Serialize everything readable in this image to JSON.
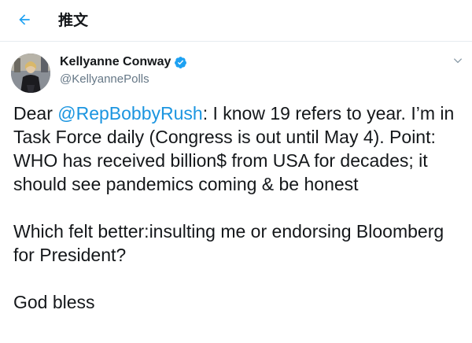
{
  "header": {
    "title": "推文",
    "back_icon": "arrow-left-icon",
    "accent_color": "#1da1f2"
  },
  "author": {
    "display_name": "Kellyanne Conway",
    "handle": "@KellyannePolls",
    "verified_icon": "verified-badge-icon",
    "menu_icon": "chevron-down-icon"
  },
  "tweet": {
    "p1_prefix": "Dear ",
    "p1_mention": "@RepBobbyRush",
    "p1_suffix": ": I know 19 refers to year. I’m in Task Force daily (Congress is out until May 4). Point: WHO has received billion$ from USA for decades; it should see pandemics coming & be honest",
    "p2": "Which felt better:insulting me or endorsing Bloomberg for President?",
    "p3": "God bless"
  },
  "colors": {
    "link": "#1b95e0",
    "text": "#14171a",
    "secondary": "#657786"
  }
}
